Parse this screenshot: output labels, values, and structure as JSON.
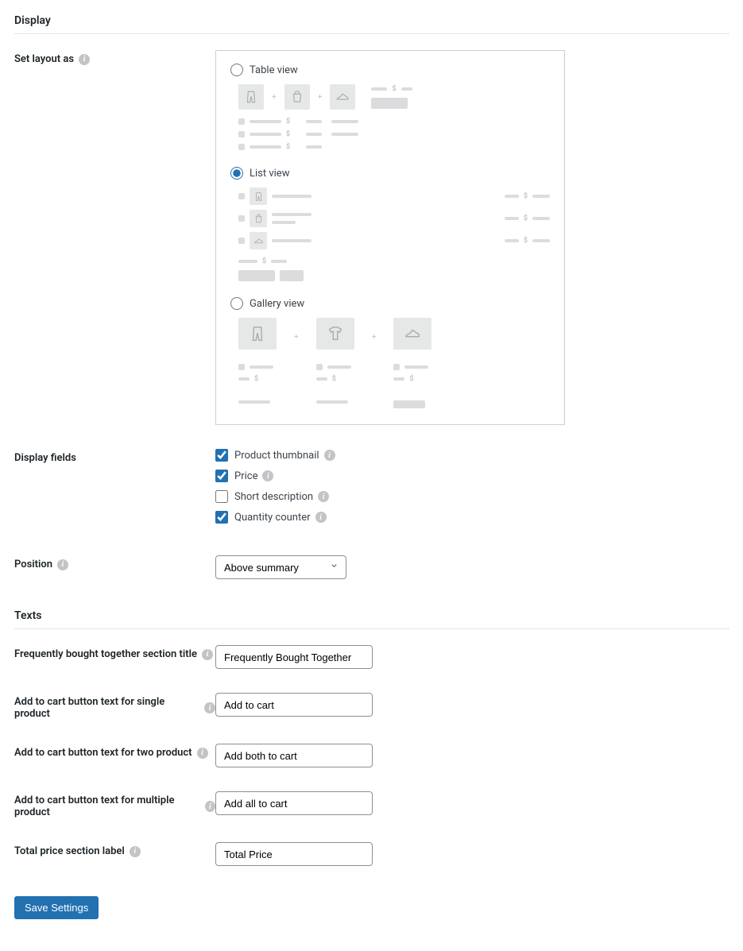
{
  "display": {
    "section_title": "Display",
    "layout": {
      "label": "Set layout as",
      "options": {
        "table": "Table view",
        "list": "List view",
        "gallery": "Gallery view"
      },
      "selected": "list"
    },
    "fields": {
      "label": "Display fields",
      "items": [
        {
          "key": "thumbnail",
          "label": "Product thumbnail",
          "checked": true
        },
        {
          "key": "price",
          "label": "Price",
          "checked": true
        },
        {
          "key": "short_desc",
          "label": "Short description",
          "checked": false
        },
        {
          "key": "qty_counter",
          "label": "Quantity counter",
          "checked": true
        }
      ]
    },
    "position": {
      "label": "Position",
      "value": "Above summary",
      "options": [
        "Above summary"
      ]
    }
  },
  "texts": {
    "section_title": "Texts",
    "fbt_title": {
      "label": "Frequently bought together section title",
      "value": "Frequently Bought Together"
    },
    "add_single": {
      "label": "Add to cart button text for single product",
      "value": "Add to cart"
    },
    "add_two": {
      "label": "Add to cart button text for two product",
      "value": "Add both to cart"
    },
    "add_multiple": {
      "label": "Add to cart button text for multiple product",
      "value": "Add all to cart"
    },
    "total_label": {
      "label": "Total price section label",
      "value": "Total Price"
    }
  },
  "actions": {
    "save": "Save Settings"
  },
  "colors": {
    "primary": "#2271b1"
  }
}
